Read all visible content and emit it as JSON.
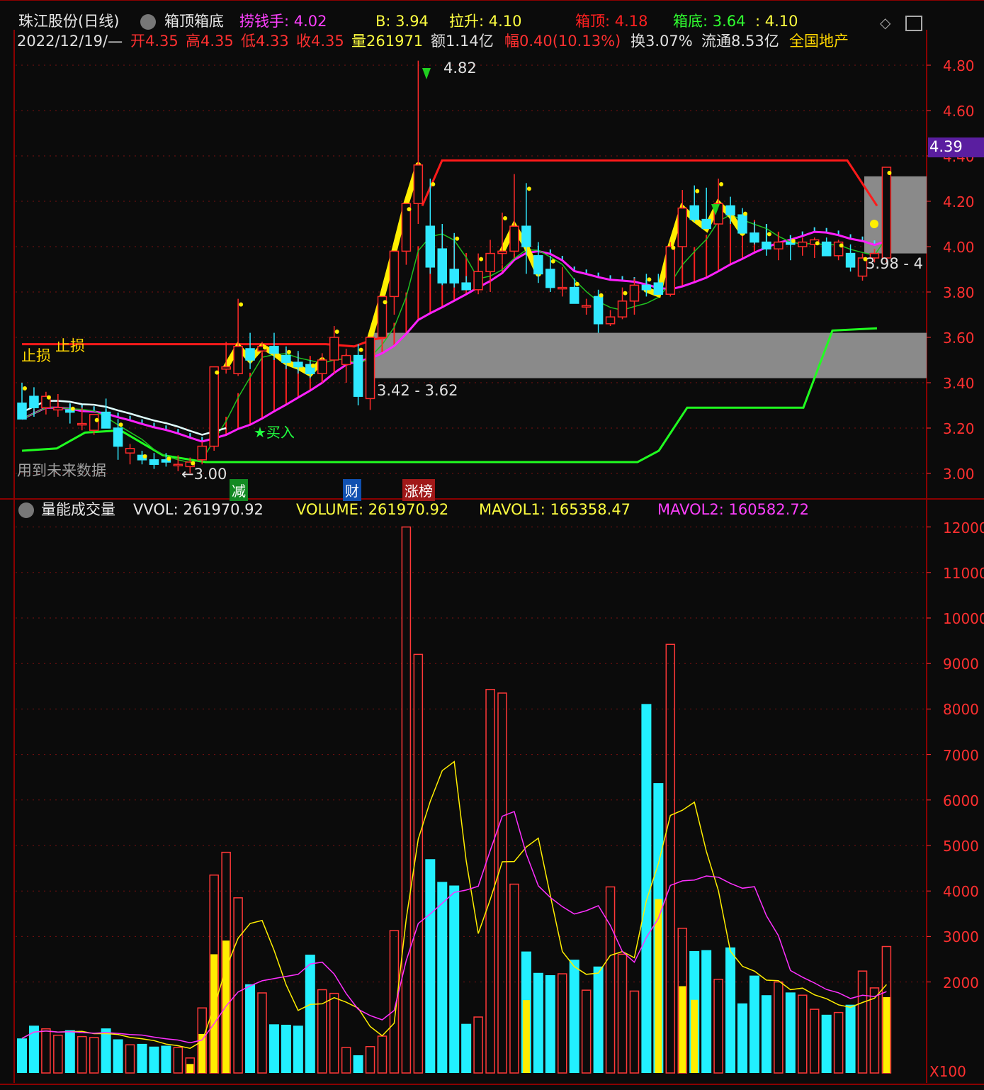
{
  "header": {
    "stock": "珠江股份(日线)",
    "indicator_name": "箱顶箱底",
    "lqs_label": "捞钱手: 4.02",
    "b_label": "B: 3.94",
    "ls_label": "拉升: 4.10",
    "xd_label": "箱顶: 4.18",
    "xdi_label": "箱底: 3.64",
    "xdi2_label": ": 4.10",
    "date": "2022/12/19/—",
    "open": "开4.35",
    "high": "高4.35",
    "low": "低4.33",
    "close": "收4.35",
    "volume": "量261971",
    "amount": "额1.14亿",
    "change": "幅0.40(10.13%)",
    "turnover": "换3.07%",
    "float_cap": "流通8.53亿",
    "sector": "全国地产"
  },
  "main_chart": {
    "price_axis": [
      "4.80",
      "4.60",
      "4.40",
      "4.20",
      "4.00",
      "3.80",
      "3.60",
      "3.40",
      "3.20",
      "3.00"
    ],
    "current_price_tag": "4.39",
    "peak_label": "4.82",
    "low_label": "←3.00",
    "box1_label": "3.42 - 3.62",
    "box2_label": "3.98 - 4",
    "stop_loss_label1": "止损",
    "stop_loss_label2": "止损",
    "buy_label": "★买入",
    "future_data_note": "用到未来数据",
    "event_tags": [
      {
        "text": "减",
        "color": "#10a020"
      },
      {
        "text": "财",
        "color": "#1060d0"
      },
      {
        "text": "涨榜",
        "color": "#d02020"
      }
    ]
  },
  "volume_panel": {
    "title": "量能成交量",
    "vvol": "VVOL: 261970.92",
    "volume": "VOLUME: 261970.92",
    "mavol1": "MAVOL1: 165358.47",
    "mavol2": "MAVOL2: 160582.72",
    "axis": [
      "12000",
      "11000",
      "10000",
      "9000",
      "8000",
      "7000",
      "6000",
      "5000",
      "4000",
      "3000",
      "2000"
    ],
    "unit": "X100"
  },
  "chart_data": [
    {
      "type": "candlestick",
      "series": [
        {
          "name": "珠江股份(日线)",
          "ohlc": [
            [
              3.31,
              3.4,
              3.24,
              3.24
            ],
            [
              3.34,
              3.38,
              3.25,
              3.29
            ],
            [
              3.29,
              3.36,
              3.26,
              3.34
            ],
            [
              3.28,
              3.35,
              3.25,
              3.29
            ],
            [
              3.28,
              3.31,
              3.22,
              3.27
            ],
            [
              3.22,
              3.29,
              3.19,
              3.22
            ],
            [
              3.19,
              3.26,
              3.17,
              3.26
            ],
            [
              3.27,
              3.33,
              3.2,
              3.2
            ],
            [
              3.2,
              3.24,
              3.06,
              3.12
            ],
            [
              3.09,
              3.13,
              3.04,
              3.11
            ],
            [
              3.08,
              3.1,
              3.04,
              3.06
            ],
            [
              3.06,
              3.09,
              3.02,
              3.04
            ],
            [
              3.06,
              3.09,
              3.03,
              3.05
            ],
            [
              3.04,
              3.08,
              3.01,
              3.04
            ],
            [
              3.03,
              3.07,
              3.0,
              3.05
            ],
            [
              3.06,
              3.14,
              3.04,
              3.12
            ],
            [
              3.12,
              3.47,
              3.1,
              3.47
            ],
            [
              3.46,
              3.58,
              3.44,
              3.47
            ],
            [
              3.44,
              3.77,
              3.43,
              3.56
            ],
            [
              3.55,
              3.62,
              3.46,
              3.5
            ],
            [
              3.54,
              3.58,
              3.46,
              3.56
            ],
            [
              3.56,
              3.62,
              3.5,
              3.53
            ],
            [
              3.52,
              3.56,
              3.46,
              3.49
            ],
            [
              3.49,
              3.54,
              3.44,
              3.47
            ],
            [
              3.48,
              3.5,
              3.42,
              3.44
            ],
            [
              3.44,
              3.53,
              3.4,
              3.5
            ],
            [
              3.5,
              3.65,
              3.44,
              3.6
            ],
            [
              3.48,
              3.55,
              3.4,
              3.52
            ],
            [
              3.52,
              3.57,
              3.3,
              3.34
            ],
            [
              3.33,
              3.6,
              3.28,
              3.6
            ],
            [
              3.6,
              3.78,
              3.55,
              3.78
            ],
            [
              3.78,
              3.98,
              3.7,
              3.98
            ],
            [
              3.98,
              4.19,
              3.92,
              4.19
            ],
            [
              4.19,
              4.82,
              4.1,
              4.36
            ],
            [
              4.09,
              4.3,
              3.88,
              3.91
            ],
            [
              3.99,
              4.1,
              3.83,
              3.84
            ],
            [
              3.9,
              4.06,
              3.82,
              3.84
            ],
            [
              3.84,
              3.87,
              3.81,
              3.81
            ],
            [
              3.81,
              3.97,
              3.79,
              3.89
            ],
            [
              3.89,
              4.03,
              3.8,
              3.97
            ],
            [
              3.97,
              4.15,
              3.92,
              3.98
            ],
            [
              3.98,
              4.32,
              3.96,
              4.09
            ],
            [
              4.09,
              4.28,
              3.88,
              4.0
            ],
            [
              3.96,
              4.02,
              3.84,
              3.88
            ],
            [
              3.9,
              3.96,
              3.8,
              3.82
            ],
            [
              3.82,
              3.91,
              3.78,
              3.82
            ],
            [
              3.82,
              3.86,
              3.75,
              3.75
            ],
            [
              3.74,
              3.77,
              3.7,
              3.74
            ],
            [
              3.78,
              3.81,
              3.62,
              3.66
            ],
            [
              3.66,
              3.72,
              3.65,
              3.69
            ],
            [
              3.69,
              3.82,
              3.68,
              3.76
            ],
            [
              3.76,
              3.86,
              3.7,
              3.83
            ],
            [
              3.83,
              3.88,
              3.78,
              3.81
            ],
            [
              3.84,
              3.88,
              3.79,
              3.79
            ],
            [
              3.79,
              4.02,
              3.78,
              4.0
            ],
            [
              4.0,
              4.25,
              3.9,
              4.17
            ],
            [
              4.18,
              4.27,
              4.11,
              4.12
            ],
            [
              4.12,
              4.26,
              4.1,
              4.08
            ],
            [
              4.1,
              4.3,
              4.0,
              4.19
            ],
            [
              4.18,
              4.22,
              4.1,
              4.14
            ],
            [
              4.14,
              4.17,
              4.06,
              4.06
            ],
            [
              4.06,
              4.11,
              4.01,
              4.02
            ],
            [
              4.02,
              4.08,
              3.96,
              3.99
            ],
            [
              3.99,
              4.06,
              3.94,
              4.02
            ],
            [
              4.02,
              4.05,
              3.94,
              4.01
            ],
            [
              4.0,
              4.04,
              3.96,
              4.02
            ],
            [
              4.01,
              4.04,
              3.95,
              4.03
            ],
            [
              4.02,
              4.04,
              3.96,
              3.96
            ],
            [
              3.96,
              4.03,
              3.94,
              4.02
            ],
            [
              3.97,
              4.01,
              3.89,
              3.91
            ],
            [
              3.87,
              3.97,
              3.85,
              3.95
            ],
            [
              3.95,
              3.99,
              3.93,
              3.97
            ],
            [
              3.95,
              4.35,
              3.93,
              4.35
            ]
          ]
        }
      ],
      "ylim": [
        3.0,
        4.85
      ]
    },
    {
      "type": "bar",
      "series": [
        {
          "name": "VOLUME",
          "values": [
            760,
            1040,
            970,
            830,
            940,
            800,
            780,
            980,
            740,
            620,
            640,
            580,
            600,
            560,
            330,
            1430,
            4350,
            4850,
            3850,
            1950,
            1760,
            1070,
            1060,
            1040,
            2600,
            1830,
            1750,
            560,
            390,
            580,
            810,
            3130,
            12000,
            9200,
            4700,
            4200,
            4120,
            1080,
            1230,
            8430,
            8350,
            4150,
            2670,
            2200,
            2150,
            2180,
            2490,
            1820,
            2340,
            4090,
            2610,
            1800,
            8110,
            6370,
            9420,
            3180,
            2680,
            2700,
            2060,
            2760,
            1530,
            2140,
            1710,
            2000,
            1770,
            1710,
            1400,
            1280,
            1330,
            1500,
            2240,
            1870,
            2780
          ]
        }
      ],
      "ylim": [
        0,
        12000
      ]
    }
  ]
}
